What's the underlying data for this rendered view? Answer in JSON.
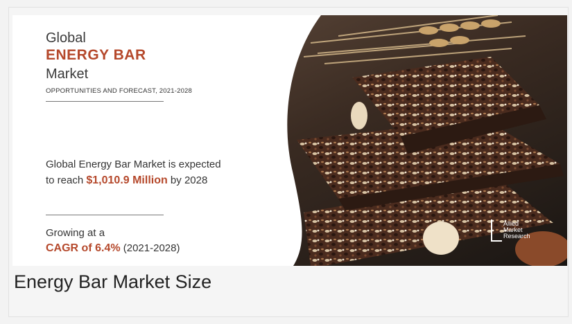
{
  "banner": {
    "title_line1": "Global",
    "title_brand": "ENERGY BAR",
    "title_line3": "Market",
    "subtitle": "OPPORTUNITIES AND FORECAST, 2021-2028",
    "stat_prefix": "Global Energy Bar Market is expected to reach ",
    "stat_value": "$1,010.9 Million",
    "stat_suffix": " by 2028",
    "growing_label": "Growing at a",
    "cagr_value": "CAGR of 6.4%",
    "cagr_period": " (2021-2028)",
    "logo_text": [
      "Allied",
      "Market",
      "Research"
    ]
  },
  "caption": "Energy Bar Market Size",
  "colors": {
    "accent": "#b5482b",
    "panel_bg": "#ffffff",
    "photo_dark": "#1d1a18"
  }
}
